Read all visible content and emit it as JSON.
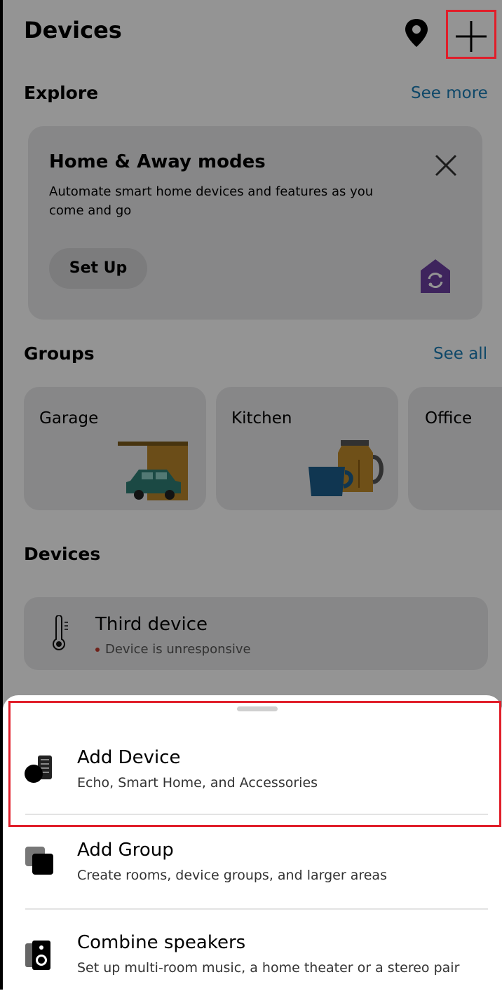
{
  "header": {
    "title": "Devices"
  },
  "explore": {
    "title": "Explore",
    "see_more": "See more",
    "card": {
      "title": "Home & Away modes",
      "description": "Automate smart home devices and features as you come and go",
      "setup_label": "Set Up"
    }
  },
  "groups": {
    "title": "Groups",
    "see_all": "See all",
    "items": [
      {
        "label": "Garage"
      },
      {
        "label": "Kitchen"
      },
      {
        "label": "Office"
      }
    ]
  },
  "devices": {
    "title": "Devices",
    "items": [
      {
        "name": "Third device",
        "status": "Device is unresponsive"
      }
    ]
  },
  "sheet": {
    "items": [
      {
        "title": "Add Device",
        "subtitle": "Echo, Smart Home, and Accessories",
        "icon": "add-device-icon"
      },
      {
        "title": "Add Group",
        "subtitle": "Create rooms, device groups, and larger areas",
        "icon": "add-group-icon"
      },
      {
        "title": "Combine speakers",
        "subtitle": "Set up multi-room music, a home theater or a stereo pair",
        "icon": "speakers-icon"
      }
    ]
  },
  "colors": {
    "link": "#1a7db6",
    "highlight": "#e01e2a",
    "status_error": "#c0392b",
    "accent_purple": "#6b3fa0"
  }
}
